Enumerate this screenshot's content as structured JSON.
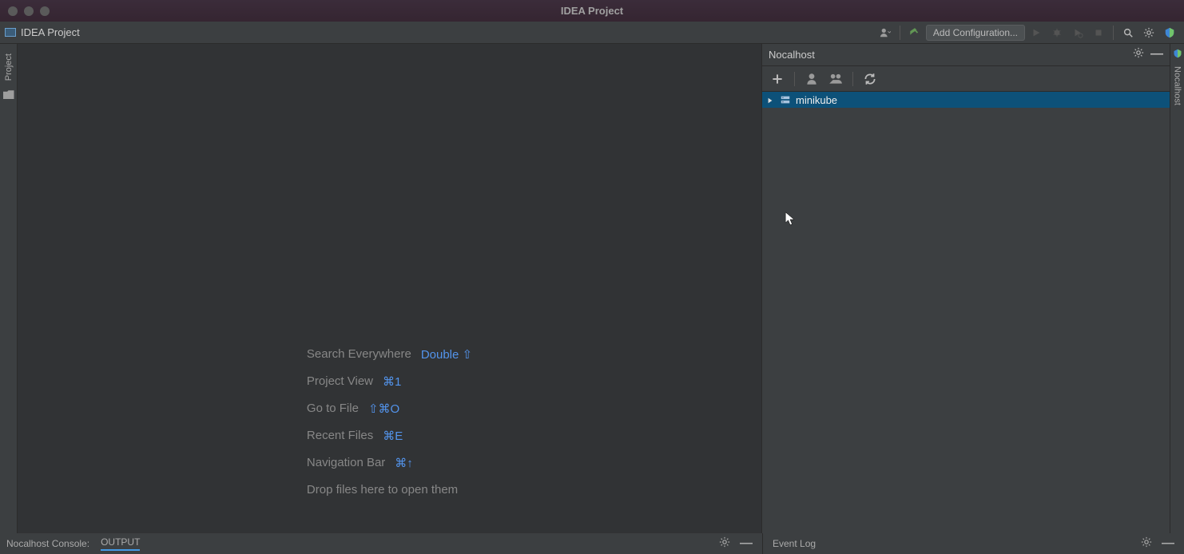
{
  "window": {
    "title": "IDEA Project"
  },
  "breadcrumb": {
    "project": "IDEA Project"
  },
  "toolbar": {
    "addConfig": "Add Configuration..."
  },
  "leftGutter": {
    "project": "Project"
  },
  "rightGutter": {
    "nocalhost": "Nocalhost"
  },
  "editor": {
    "hints": {
      "searchEverywhere": {
        "label": "Search Everywhere",
        "shortcut": "Double ⇧"
      },
      "projectView": {
        "label": "Project View",
        "shortcut": "⌘1"
      },
      "goToFile": {
        "label": "Go to File",
        "shortcut": "⇧⌘O"
      },
      "recentFiles": {
        "label": "Recent Files",
        "shortcut": "⌘E"
      },
      "navBar": {
        "label": "Navigation Bar",
        "shortcut": "⌘↑"
      },
      "drop": "Drop files here to open them"
    }
  },
  "rightPanel": {
    "title": "Nocalhost",
    "tree": {
      "node0": "minikube"
    }
  },
  "statusbar": {
    "consoleLabel": "Nocalhost Console:",
    "outputTab": "OUTPUT",
    "eventLog": "Event Log"
  }
}
